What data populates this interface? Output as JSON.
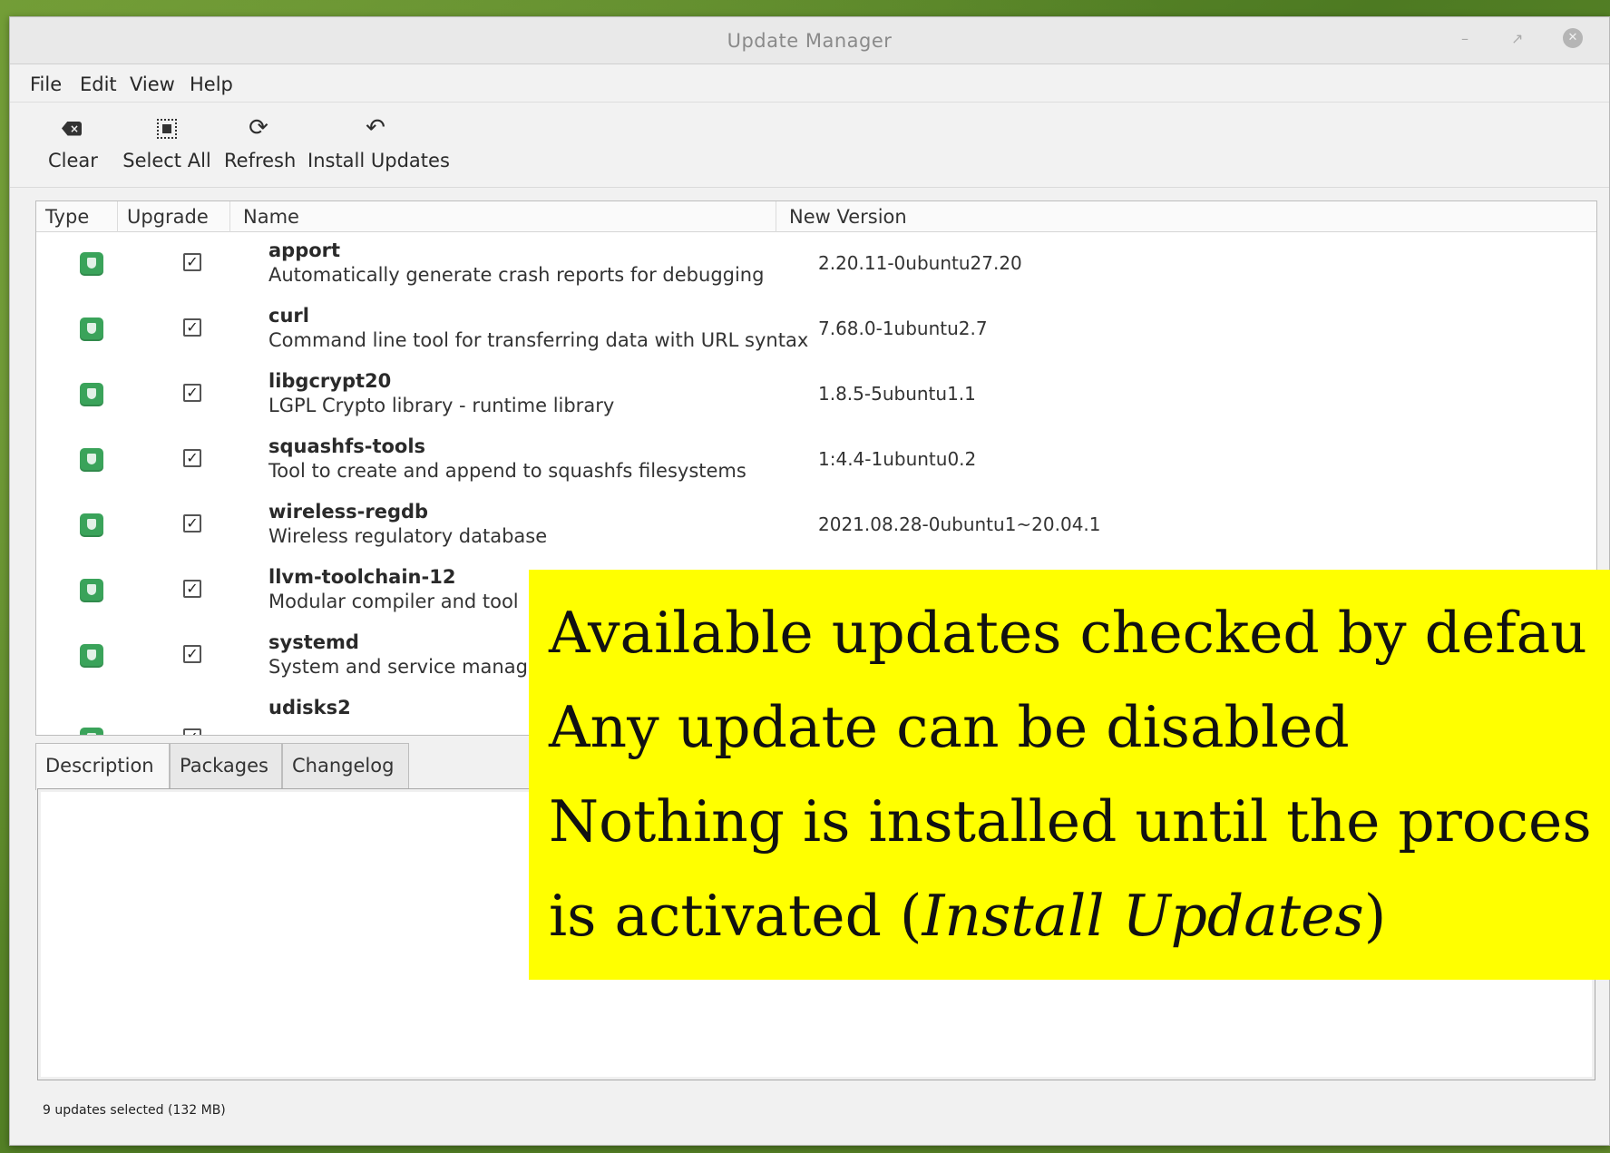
{
  "window": {
    "title": "Update Manager",
    "controls": [
      "–",
      "↗",
      "✕"
    ]
  },
  "menu": [
    "File",
    "Edit",
    "View",
    "Help"
  ],
  "toolbar": {
    "clear": "Clear",
    "select_all": "Select All",
    "refresh": "Refresh",
    "install_updates": "Install Updates"
  },
  "columns": [
    "Type",
    "Upgrade",
    "Name",
    "New Version"
  ],
  "updates": [
    {
      "name": "apport",
      "desc": "Automatically generate crash reports for debugging",
      "version": "2.20.11-0ubuntu27.20",
      "checked": true
    },
    {
      "name": "curl",
      "desc": "Command line tool for transferring data with URL syntax",
      "version": "7.68.0-1ubuntu2.7",
      "checked": true
    },
    {
      "name": "libgcrypt20",
      "desc": "LGPL Crypto library - runtime library",
      "version": "1.8.5-5ubuntu1.1",
      "checked": true
    },
    {
      "name": "squashfs-tools",
      "desc": "Tool to create and append to squashfs filesystems",
      "version": "1:4.4-1ubuntu0.2",
      "checked": true
    },
    {
      "name": "wireless-regdb",
      "desc": "Wireless regulatory database",
      "version": "2021.08.28-0ubuntu1~20.04.1",
      "checked": true
    },
    {
      "name": "llvm-toolchain-12",
      "desc": "Modular compiler and tool",
      "version": "",
      "checked": true
    },
    {
      "name": "systemd",
      "desc": "System and service manag",
      "version": "",
      "checked": true
    },
    {
      "name": "udisks2",
      "desc": "",
      "version": "",
      "checked": true
    }
  ],
  "tabs": [
    "Description",
    "Packages",
    "Changelog"
  ],
  "status": "9 updates selected (132 MB)",
  "callout": {
    "line1": "Available updates checked by defau",
    "line2": "Any update can be disabled",
    "line3": "Nothing is installed until the proces",
    "line4_prefix": "is activated (",
    "line4_italic": "Install Updates",
    "line4_suffix": ")"
  },
  "colors": {
    "callout_bg": "#ffff00",
    "shield": "#3aa35a"
  }
}
